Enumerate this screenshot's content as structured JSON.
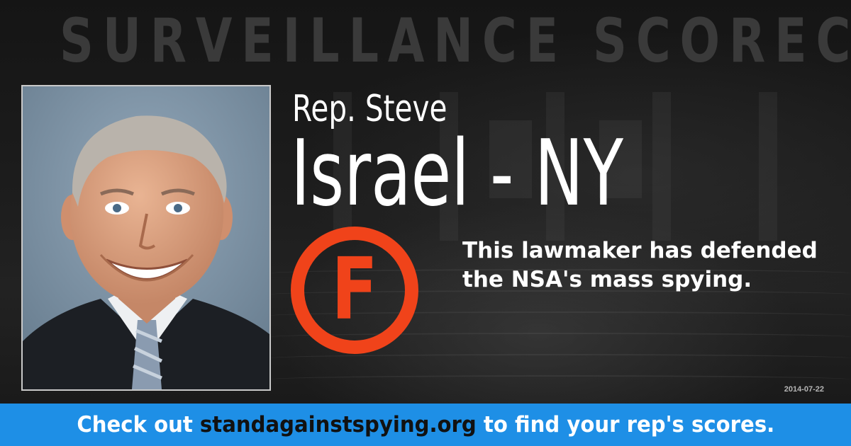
{
  "header": {
    "title": "SURVEILLANCE SCORECARD"
  },
  "representative": {
    "first_line": "Rep. Steve",
    "second_line": "Israel - NY",
    "photo_alt": "portrait-photo"
  },
  "grade": {
    "letter": "F",
    "color": "#f0431a"
  },
  "message": "This lawmaker has defended the NSA's mass spying.",
  "date": "2014-07-22",
  "footer": {
    "prefix": "Check out ",
    "link": "standagainstspying.org",
    "suffix": " to find your rep's scores.",
    "background": "#1e8fe6"
  }
}
